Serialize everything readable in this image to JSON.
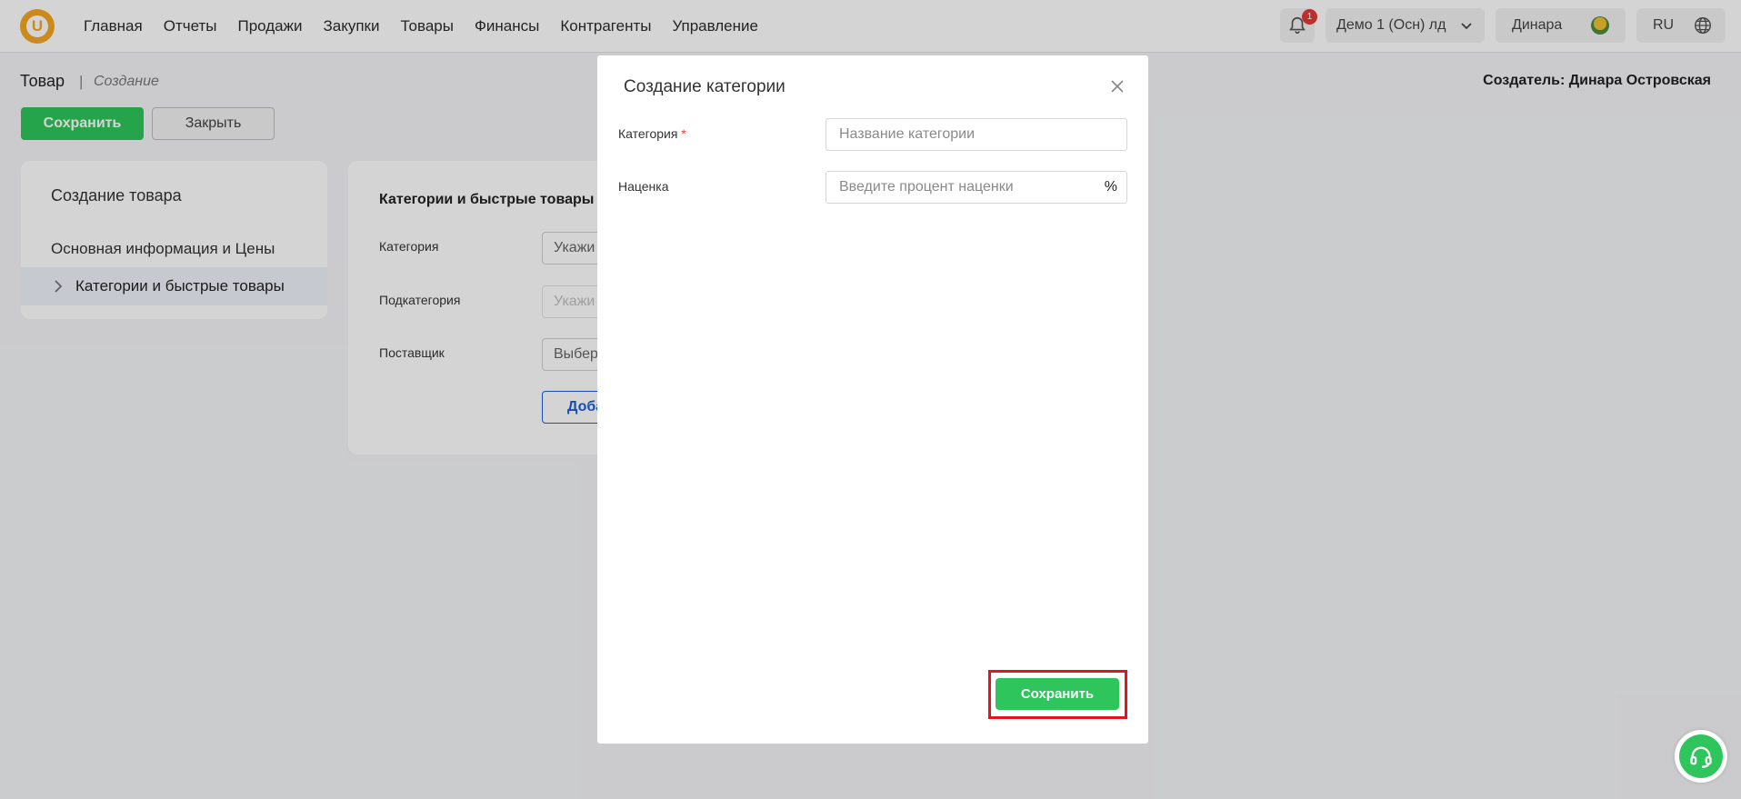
{
  "nav": {
    "items": [
      "Главная",
      "Отчеты",
      "Продажи",
      "Закупки",
      "Товары",
      "Финансы",
      "Контрагенты",
      "Управление"
    ]
  },
  "header": {
    "notification_count": "1",
    "company": "Демо 1 (Осн) лд",
    "user": "Динара",
    "language": "RU"
  },
  "page": {
    "breadcrumb": "Товар",
    "breadcrumb_separator": "|",
    "breadcrumb_sub": "Создание",
    "creator": "Создатель: Динара Островская",
    "save_label": "Сохранить",
    "close_label": "Закрыть"
  },
  "left_panel": {
    "title": "Создание товара",
    "items": [
      "Основная информация и Цены",
      "Категории и быстрые товары"
    ]
  },
  "right_panel": {
    "title": "Категории и быстрые товары",
    "category_label": "Категория",
    "category_value": "Укажи",
    "subcategory_label": "Подкатегория",
    "subcategory_value": "Укажи",
    "supplier_label": "Поставщик",
    "supplier_value": "Выбер",
    "add_label": "Доба"
  },
  "modal": {
    "title": "Создание категории",
    "category_label": "Категория",
    "required_mark": "*",
    "category_placeholder": "Название категории",
    "markup_label": "Наценка",
    "markup_placeholder": "Введите процент наценки",
    "markup_unit": "%",
    "save_label": "Сохранить"
  },
  "colors": {
    "accent_green": "#2ec65c",
    "logo_orange": "#f5a623",
    "highlight_red": "#e3141b",
    "link_blue": "#1a5fd6"
  }
}
